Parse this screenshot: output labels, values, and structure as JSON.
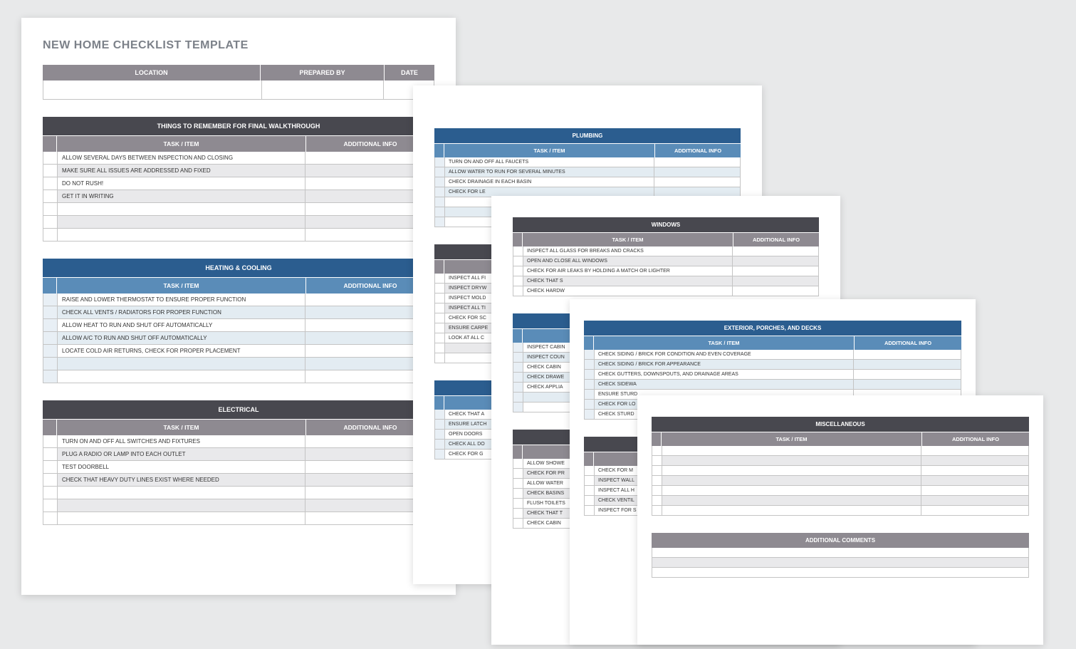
{
  "title": "NEW HOME CHECKLIST TEMPLATE",
  "info_header": {
    "location": "LOCATION",
    "prepared_by": "PREPARED BY",
    "date": "DATE"
  },
  "cols": {
    "task": "TASK / ITEM",
    "info": "ADDITIONAL INFO"
  },
  "sections": {
    "remember": {
      "title": "THINGS TO REMEMBER FOR FINAL WALKTHROUGH",
      "items": [
        "ALLOW SEVERAL DAYS BETWEEN INSPECTION AND CLOSING",
        "MAKE SURE ALL ISSUES ARE ADDRESSED AND FIXED",
        "DO NOT RUSH!",
        "GET IT IN WRITING"
      ]
    },
    "heating": {
      "title": "HEATING & COOLING",
      "items": [
        "RAISE AND LOWER THERMOSTAT TO ENSURE PROPER FUNCTION",
        "CHECK ALL VENTS / RADIATORS FOR PROPER FUNCTION",
        "ALLOW HEAT TO RUN AND SHUT OFF AUTOMATICALLY",
        "ALLOW A/C TO RUN AND SHUT OFF AUTOMATICALLY",
        "LOCATE COLD AIR RETURNS, CHECK FOR PROPER PLACEMENT"
      ]
    },
    "electrical": {
      "title": "ELECTRICAL",
      "items": [
        "TURN ON AND OFF ALL SWITCHES AND FIXTURES",
        "PLUG A RADIO OR LAMP INTO EACH OUTLET",
        "TEST DOORBELL",
        "CHECK THAT HEAVY DUTY LINES EXIST WHERE NEEDED"
      ]
    },
    "plumbing": {
      "title": "PLUMBING",
      "items": [
        "TURN ON AND OFF ALL FAUCETS",
        "ALLOW WATER TO RUN FOR SEVERAL MINUTES",
        "CHECK DRAINAGE IN EACH BASIN",
        "CHECK FOR LE"
      ]
    },
    "walls": {
      "items": [
        "INSPECT ALL FI",
        "INSPECT DRYW",
        "INSPECT MOLD",
        "INSPECT ALL TI",
        "CHECK FOR SC",
        "ENSURE CARPE",
        "LOOK AT ALL C"
      ]
    },
    "doors": {
      "items": [
        "CHECK THAT A",
        "ENSURE LATCH",
        "OPEN DOORS",
        "CHECK ALL DO",
        "CHECK FOR G"
      ]
    },
    "windows": {
      "title": "WINDOWS",
      "items": [
        "INSPECT ALL GLASS FOR BREAKS AND CRACKS",
        "OPEN AND CLOSE ALL WINDOWS",
        "CHECK FOR AIR LEAKS BY HOLDING A MATCH OR LIGHTER",
        "CHECK THAT S",
        "CHECK HARDW"
      ]
    },
    "kitchen": {
      "items": [
        "INSPECT CABIN",
        "INSPECT COUN",
        "CHECK CABIN",
        "CHECK DRAWE",
        "CHECK APPLIA"
      ]
    },
    "bath": {
      "items": [
        "ALLOW SHOWE",
        "CHECK FOR PR",
        "ALLOW WATER",
        "CHECK BASINS",
        "FLUSH TOILETS",
        "CHECK THAT T",
        "CHECK CABIN"
      ]
    },
    "exterior": {
      "title": "EXTERIOR, PORCHES, AND DECKS",
      "items": [
        "CHECK SIDING / BRICK FOR CONDITION AND EVEN COVERAGE",
        "CHECK SIDING / BRICK FOR APPEARANCE",
        "CHECK GUTTERS, DOWNSPOUTS, AND DRAINAGE AREAS",
        "CHECK SIDEWA",
        "ENSURE STURD",
        "CHECK FOR LO",
        "CHECK STURD"
      ]
    },
    "garage": {
      "items": [
        "CHECK FOR M",
        "INSPECT WALL",
        "INSPECT ALL H",
        "CHECK VENTIL",
        "INSPECT FOR S"
      ]
    },
    "misc": {
      "title": "MISCELLANEOUS"
    },
    "comments": {
      "title": "ADDITIONAL COMMENTS"
    }
  }
}
